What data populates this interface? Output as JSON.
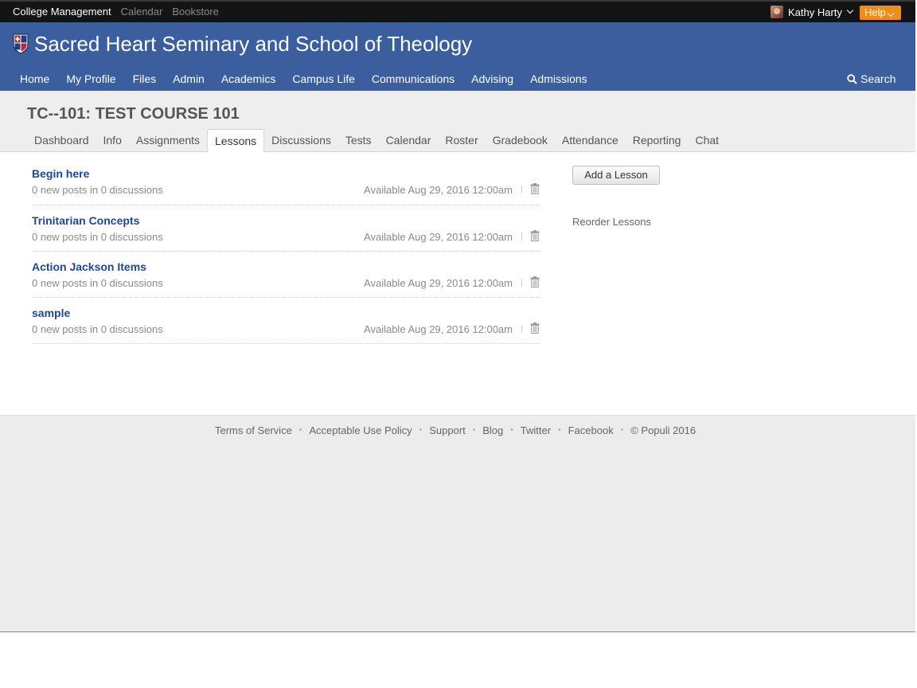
{
  "topbar": {
    "links": [
      "College Management",
      "Calendar",
      "Bookstore"
    ],
    "user_name": "Kathy Harty",
    "help_label": "Help"
  },
  "header": {
    "school_name": "Sacred Heart Seminary and School of Theology",
    "nav": [
      "Home",
      "My Profile",
      "Files",
      "Admin",
      "Academics",
      "Campus Life",
      "Communications",
      "Advising",
      "Admissions"
    ],
    "search_label": "Search"
  },
  "course": {
    "title": "TC--101: TEST COURSE 101",
    "tabs": [
      "Dashboard",
      "Info",
      "Assignments",
      "Lessons",
      "Discussions",
      "Tests",
      "Calendar",
      "Roster",
      "Gradebook",
      "Attendance",
      "Reporting",
      "Chat"
    ],
    "active_tab": "Lessons"
  },
  "lessons": [
    {
      "title": "Begin here",
      "posts": "0 new posts in 0 discussions",
      "available": "Available Aug 29, 2016 12:00am"
    },
    {
      "title": "Trinitarian Concepts",
      "posts": "0 new posts in 0 discussions",
      "available": "Available Aug 29, 2016 12:00am"
    },
    {
      "title": "Action Jackson Items",
      "posts": "0 new posts in 0 discussions",
      "available": "Available Aug 29, 2016 12:00am"
    },
    {
      "title": "sample",
      "posts": "0 new posts in 0 discussions",
      "available": "Available Aug 29, 2016 12:00am"
    }
  ],
  "sidebar": {
    "add_label": "Add a Lesson",
    "reorder_label": "Reorder Lessons"
  },
  "footer": {
    "links": [
      "Terms of Service",
      "Acceptable Use Policy",
      "Support",
      "Blog",
      "Twitter",
      "Facebook"
    ],
    "copyright": "© Populi 2016"
  },
  "colors": {
    "header_blue": "#3a5e9e",
    "help_orange": "#f08c1e",
    "link_blue": "#1f46a0"
  }
}
